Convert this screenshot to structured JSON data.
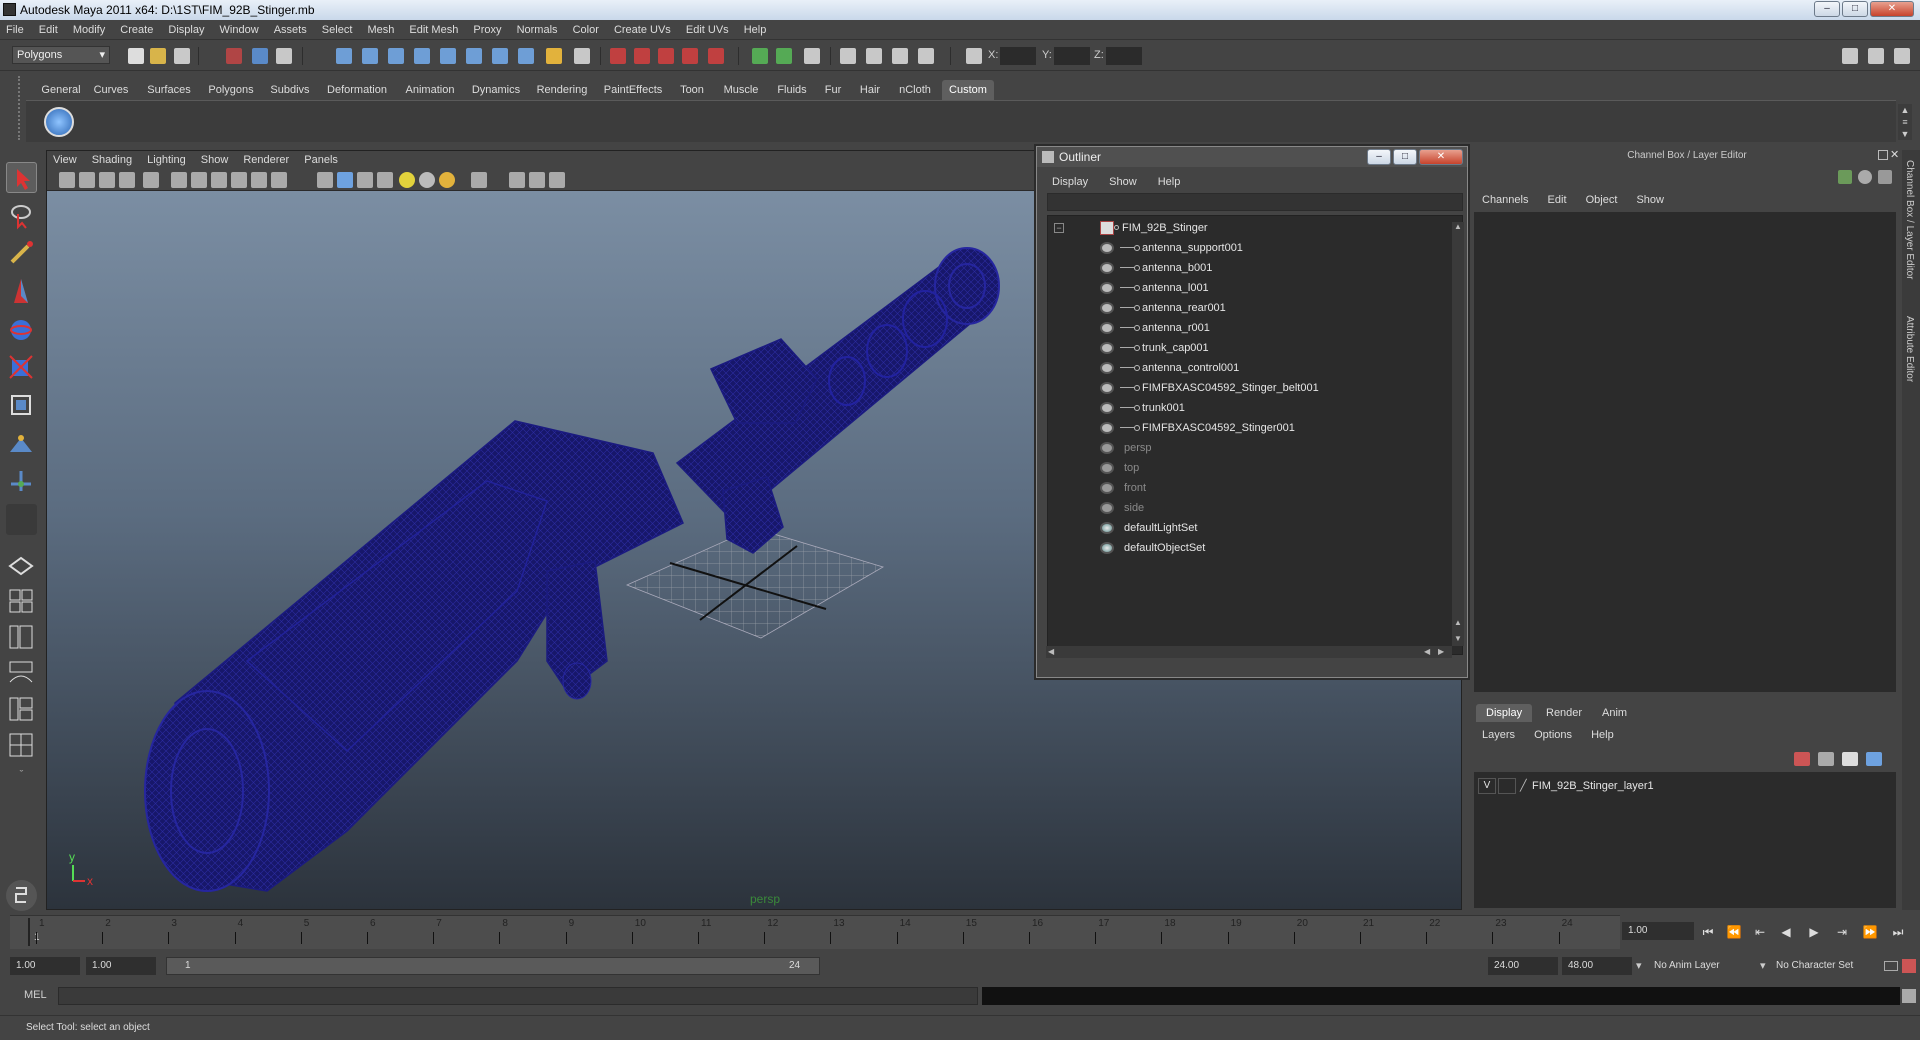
{
  "window": {
    "title": "Autodesk Maya 2011 x64: D:\\1ST\\FIM_92B_Stinger.mb",
    "controls": [
      "‒",
      "□",
      "✕"
    ]
  },
  "menubar": [
    "File",
    "Edit",
    "Modify",
    "Create",
    "Display",
    "Window",
    "Assets",
    "Select",
    "Mesh",
    "Edit Mesh",
    "Proxy",
    "Normals",
    "Color",
    "Create UVs",
    "Edit UVs",
    "Help"
  ],
  "statusline": {
    "mode": "Polygons",
    "x_label": "X:",
    "y_label": "Y:",
    "z_label": "Z:"
  },
  "shelf": {
    "tabs": [
      "General",
      "Curves",
      "Surfaces",
      "Polygons",
      "Subdivs",
      "Deformation",
      "Animation",
      "Dynamics",
      "Rendering",
      "PaintEffects",
      "Toon",
      "Muscle",
      "Fluids",
      "Fur",
      "Hair",
      "nCloth",
      "Custom"
    ],
    "active": "Custom"
  },
  "viewport": {
    "menu": [
      "View",
      "Shading",
      "Lighting",
      "Show",
      "Renderer",
      "Panels"
    ],
    "camera_label": "persp",
    "axis_y": "y",
    "axis_x": "x",
    "wire_color": "#1a1a7a"
  },
  "outliner": {
    "title": "Outliner",
    "menu": [
      "Display",
      "Show",
      "Help"
    ],
    "root": "FIM_92B_Stinger",
    "children": [
      "antenna_support001",
      "antenna_b001",
      "antenna_l001",
      "antenna_rear001",
      "antenna_r001",
      "trunk_cap001",
      "antenna_control001",
      "FIMFBXASC04592_Stinger_belt001",
      "trunk001",
      "FIMFBXASC04592_Stinger001"
    ],
    "cameras": [
      "persp",
      "top",
      "front",
      "side"
    ],
    "sets": [
      "defaultLightSet",
      "defaultObjectSet"
    ]
  },
  "channelbox": {
    "header": "Channel Box / Layer Editor",
    "menu": [
      "Channels",
      "Edit",
      "Object",
      "Show"
    ]
  },
  "layereditor": {
    "tabs": [
      "Display",
      "Render",
      "Anim"
    ],
    "active_tab": "Display",
    "menu": [
      "Layers",
      "Options",
      "Help"
    ],
    "layer": {
      "visible": "V",
      "name": "FIM_92B_Stinger_layer1"
    }
  },
  "sidetabs": [
    "Channel Box / Layer Editor",
    "Attribute Editor"
  ],
  "timeline": {
    "frames": [
      "1",
      "2",
      "3",
      "4",
      "5",
      "6",
      "7",
      "8",
      "9",
      "10",
      "11",
      "12",
      "13",
      "14",
      "15",
      "16",
      "17",
      "18",
      "19",
      "20",
      "21",
      "22",
      "23",
      "24"
    ],
    "current_marker": "1",
    "current_frame": "1.00"
  },
  "range": {
    "start_time": "1.00",
    "playback_start": "1.00",
    "slider_start": "1",
    "slider_end": "24",
    "playback_end": "24.00",
    "end_time": "48.00",
    "anim_layer": "No Anim Layer",
    "character_set": "No Character Set"
  },
  "cmdline": {
    "label": "MEL"
  },
  "helpline": {
    "text": "Select Tool: select an object"
  }
}
